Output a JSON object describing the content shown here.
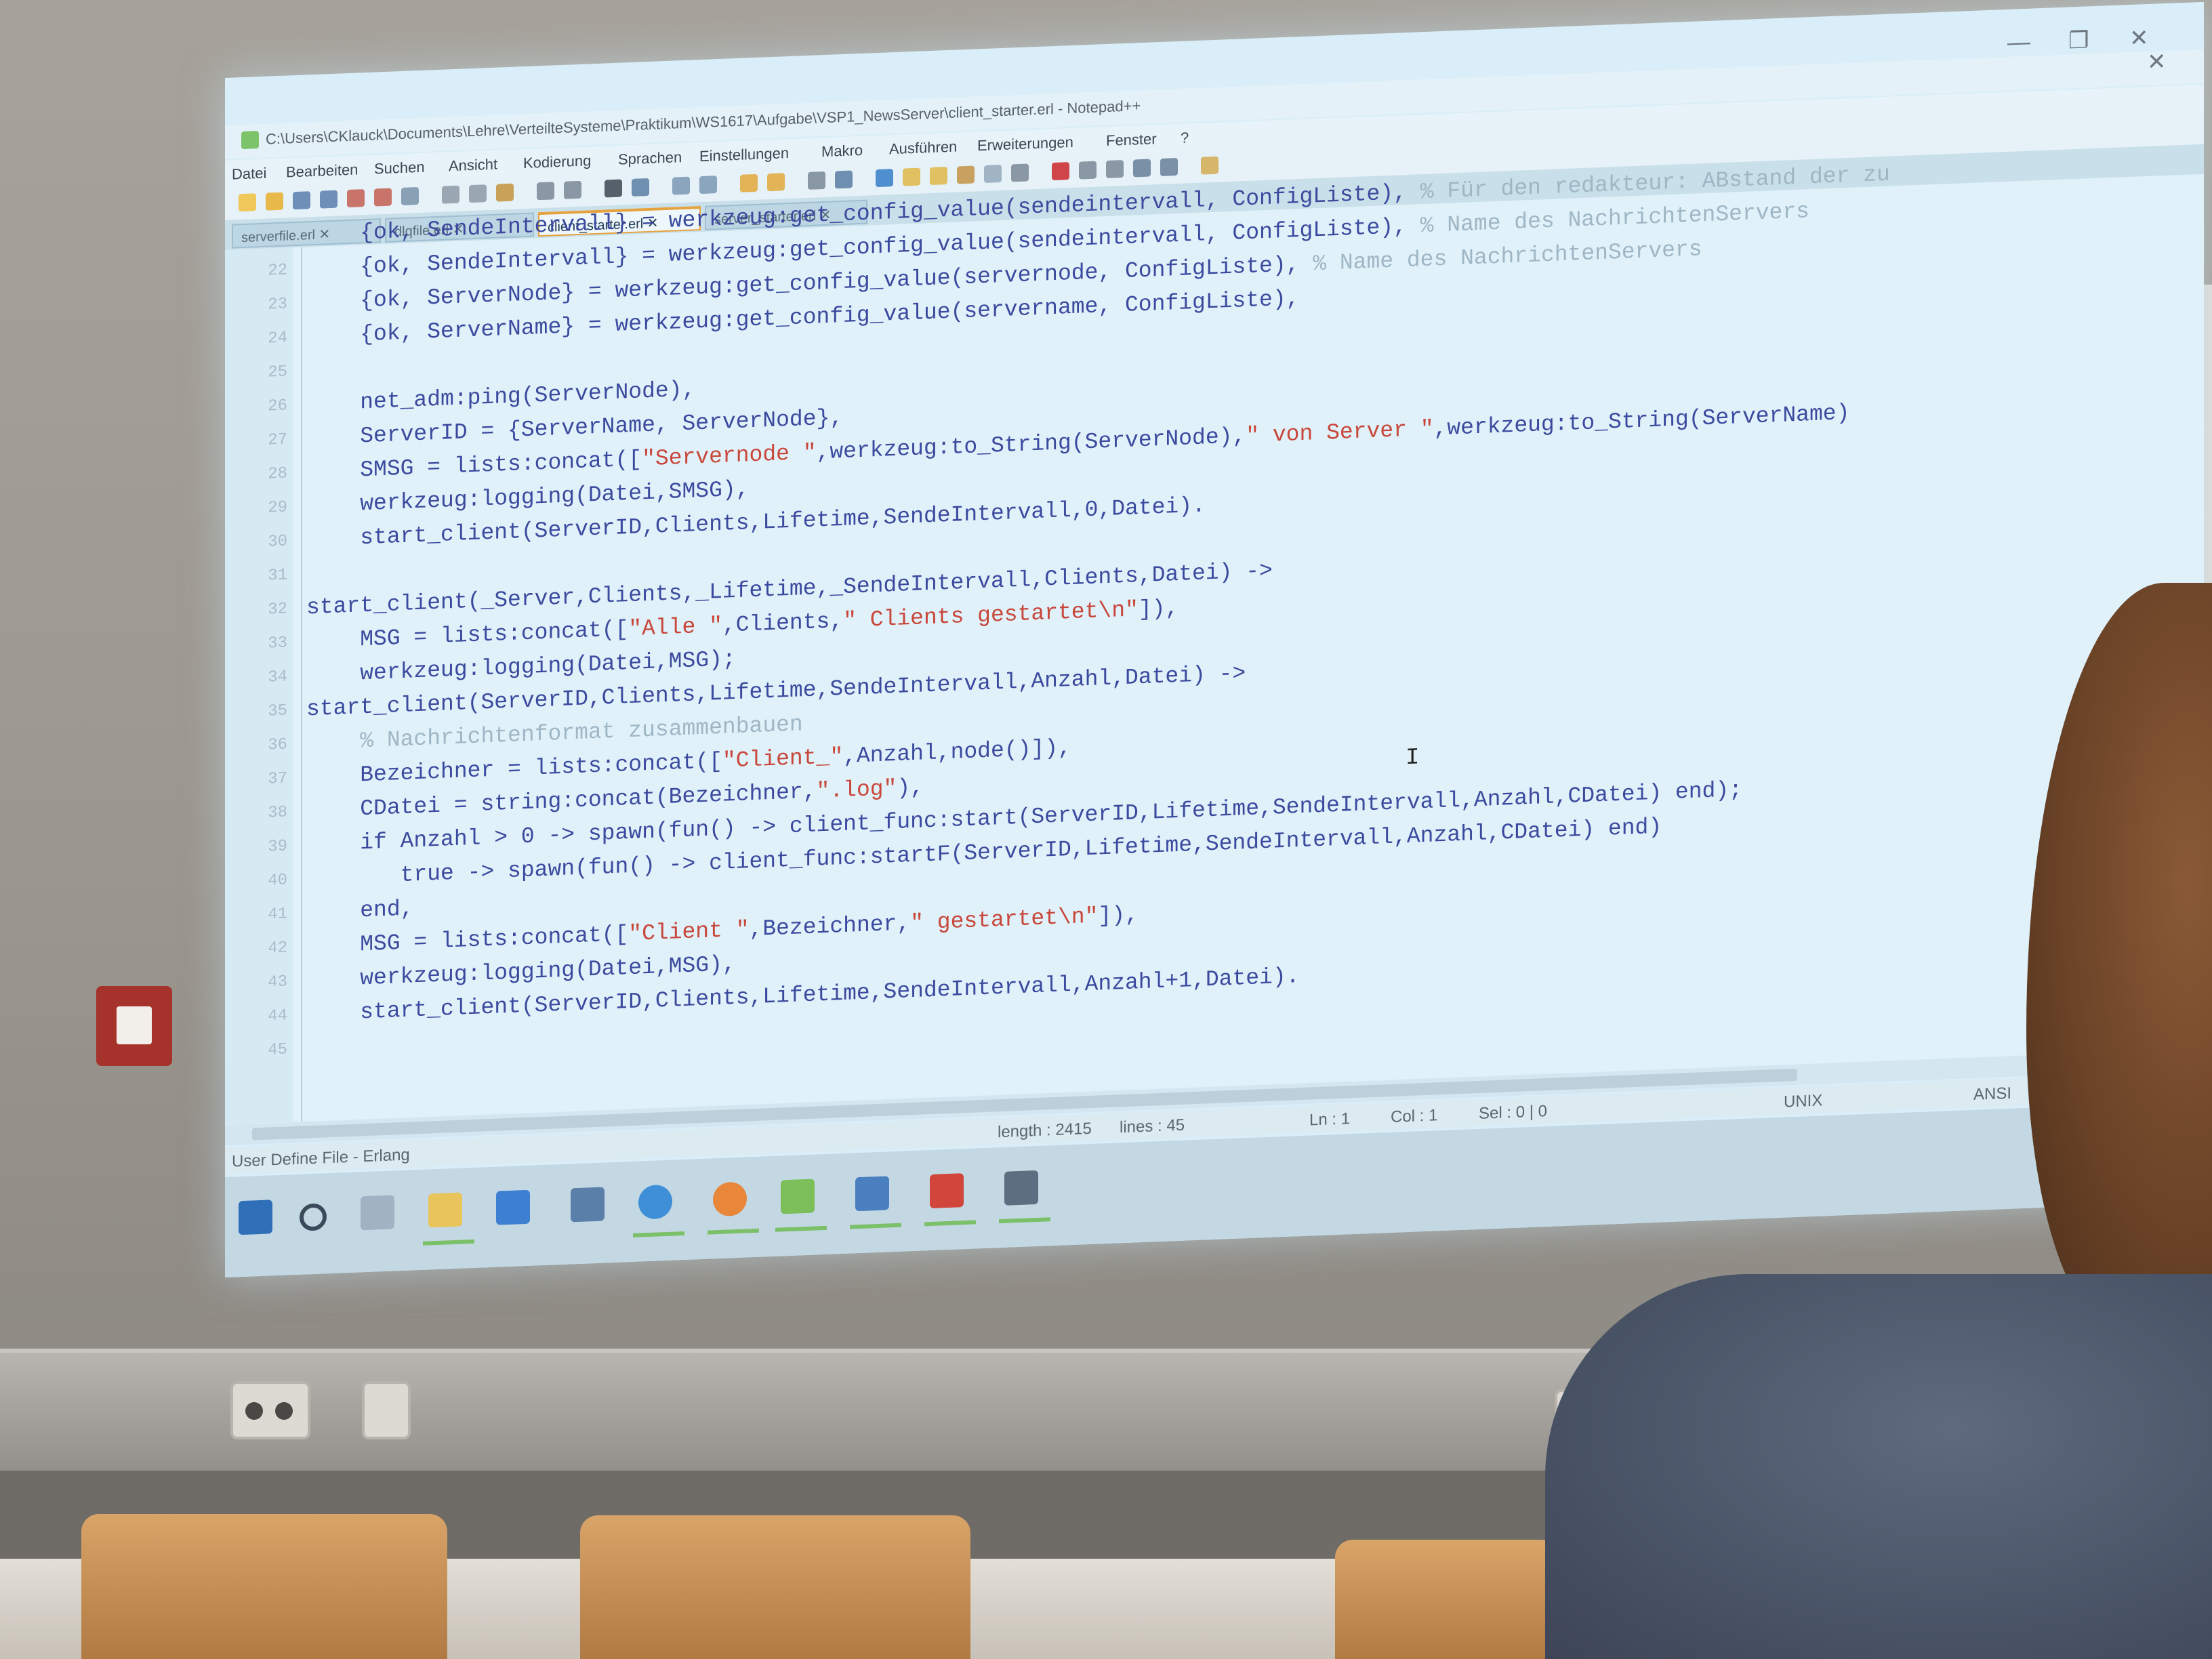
{
  "window": {
    "title": "C:\\Users\\CKlauck\\Documents\\Lehre\\VerteilteSysteme\\Praktikum\\WS1617\\Aufgabe\\VSP1_NewsServer\\client_starter.erl - Notepad++",
    "min_glyph": "—",
    "max_glyph": "❐",
    "close_glyph": "✕",
    "close2_glyph": "✕"
  },
  "menu": [
    "Datei",
    "Bearbeiten",
    "Suchen",
    "Ansicht",
    "Kodierung",
    "Sprachen",
    "Einstellungen",
    "Makro",
    "Ausführen",
    "Erweiterungen",
    "Fenster",
    "?"
  ],
  "tabs": [
    {
      "label": "serverfile.erl ✕",
      "active": false
    },
    {
      "label": "dlqfile.erl ✕",
      "active": false
    },
    {
      "label": "client_starter.erl ✕",
      "active": true
    },
    {
      "label": "server_starter.erl ✕",
      "active": false
    }
  ],
  "code_lines": [
    {
      "n": "",
      "html": "    {ok, SendeIntervall} = werkzeug:get_config_value(sendeintervall, ConfigListe), <span class=\"c\">% Für den redakteur: ABstand der zu</span>"
    },
    {
      "n": "22",
      "html": "    {ok, SendeIntervall} = werkzeug:get_config_value(sendeintervall, ConfigListe), <span class=\"c\">% Name des NachrichtenServers</span>"
    },
    {
      "n": "23",
      "html": "    {ok, ServerNode} = werkzeug:get_config_value(servernode, ConfigListe), <span class=\"c\">% Name des NachrichtenServers</span>"
    },
    {
      "n": "24",
      "html": "    {ok, ServerName} = werkzeug:get_config_value(servername, ConfigListe),"
    },
    {
      "n": "25",
      "html": ""
    },
    {
      "n": "26",
      "html": "    net_adm:ping(ServerNode),"
    },
    {
      "n": "27",
      "html": "    ServerID = {ServerName, ServerNode},"
    },
    {
      "n": "28",
      "html": "    SMSG = lists:concat([<span class=\"s\">\"Servernode \"</span>,werkzeug:to_String(ServerNode),<span class=\"s\">\" von Server \"</span>,werkzeug:to_String(ServerName)"
    },
    {
      "n": "29",
      "html": "    werkzeug:logging(Datei,SMSG),"
    },
    {
      "n": "30",
      "html": "    start_client(ServerID,Clients,Lifetime,SendeIntervall,0,Datei)."
    },
    {
      "n": "31",
      "html": ""
    },
    {
      "n": "32",
      "html": "start_client(_Server,Clients,_Lifetime,_SendeIntervall,Clients,Datei) ->"
    },
    {
      "n": "33",
      "html": "    MSG = lists:concat([<span class=\"s\">\"Alle \"</span>,Clients,<span class=\"s\">\" Clients gestartet\\n\"</span>]),"
    },
    {
      "n": "34",
      "html": "    werkzeug:logging(Datei,MSG);"
    },
    {
      "n": "35",
      "html": "start_client(ServerID,Clients,Lifetime,SendeIntervall,Anzahl,Datei) ->"
    },
    {
      "n": "36",
      "html": "    <span class=\"c\">% Nachrichtenformat zusammenbauen</span>"
    },
    {
      "n": "37",
      "html": "    Bezeichner = lists:concat([<span class=\"s\">\"Client_\"</span>,Anzahl,node()]),"
    },
    {
      "n": "38",
      "html": "    CDatei = string:concat(Bezeichner,<span class=\"s\">\".log\"</span>),"
    },
    {
      "n": "39",
      "html": "    if Anzahl > 0 -> spawn(fun() -> client_func:start(ServerID,Lifetime,SendeIntervall,Anzahl,CDatei) end);"
    },
    {
      "n": "40",
      "html": "       true -> spawn(fun() -> client_func:startF(ServerID,Lifetime,SendeIntervall,Anzahl,CDatei) end)"
    },
    {
      "n": "41",
      "html": "    end,"
    },
    {
      "n": "42",
      "html": "    MSG = lists:concat([<span class=\"s\">\"Client \"</span>,Bezeichner,<span class=\"s\">\" gestartet\\n\"</span>]),"
    },
    {
      "n": "43",
      "html": "    werkzeug:logging(Datei,MSG),"
    },
    {
      "n": "44",
      "html": "    start_client(ServerID,Clients,Lifetime,SendeIntervall,Anzahl+1,Datei)."
    },
    {
      "n": "45",
      "html": ""
    }
  ],
  "status": {
    "language": "User Define File - Erlang",
    "length": "length : 2415",
    "lines": "lines : 45",
    "ln": "Ln : 1",
    "col": "Col : 1",
    "sel": "Sel : 0 | 0",
    "eol": "UNIX",
    "encoding": "ANSI"
  },
  "cursor_glyph": "I",
  "taskbar_icons": [
    "start-icon",
    "cortana-icon",
    "task-view-icon",
    "file-explorer-icon",
    "people-icon",
    "java-icon",
    "chrome-icon",
    "firefox-icon",
    "notepadpp-icon",
    "documents-icon",
    "powerpoint-icon",
    "console-icon"
  ],
  "colors": {
    "editor_bg": "#e0f1fa",
    "keyword": "#3b4a9e",
    "string": "#c8463a",
    "comment": "#9fb6c4",
    "active_tab": "#e5a23d"
  }
}
